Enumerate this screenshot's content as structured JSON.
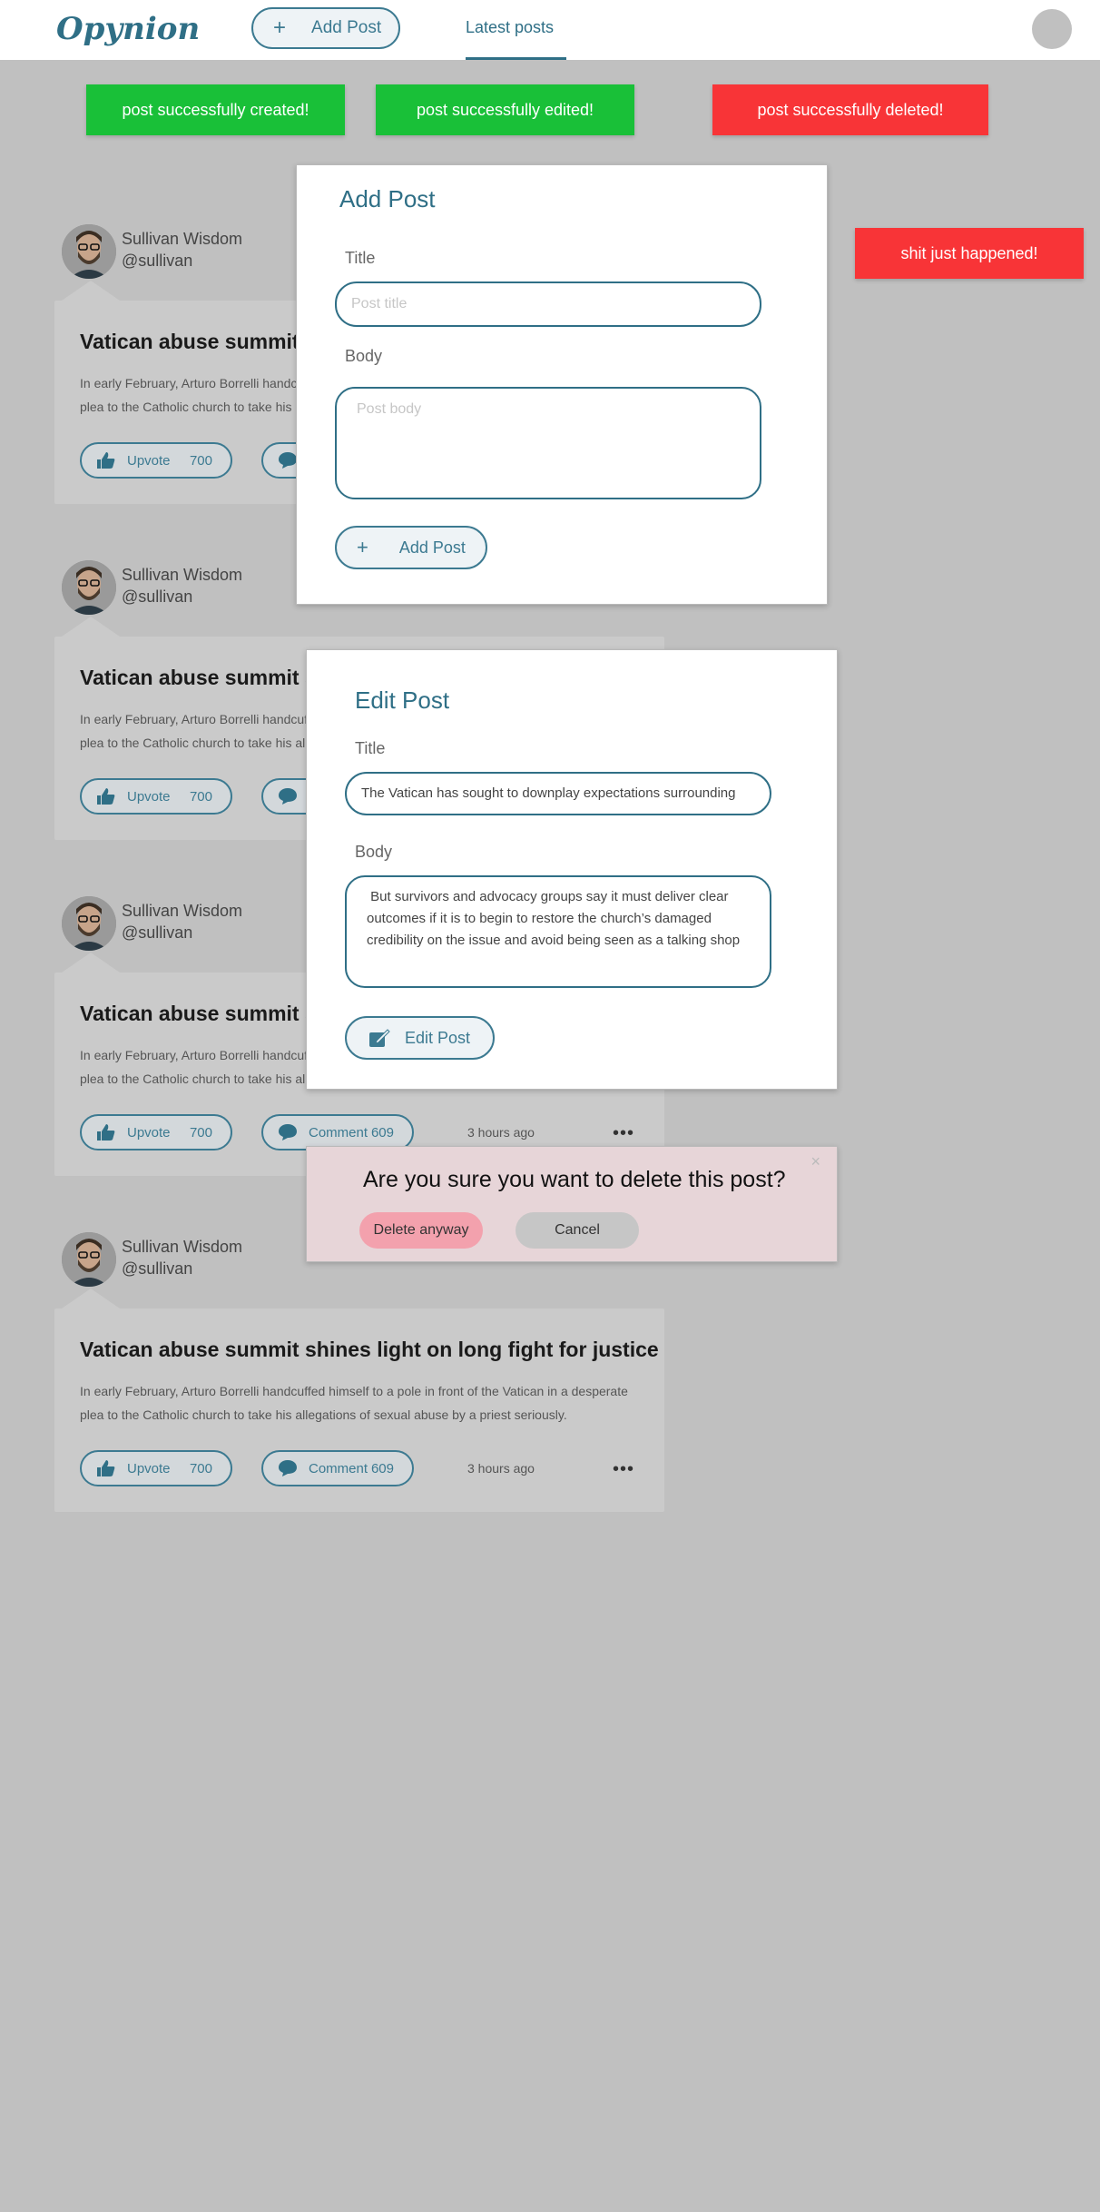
{
  "header": {
    "logo": "Opynion",
    "add_post_label": "Add Post",
    "tab_latest": "Latest posts"
  },
  "toasts": {
    "created": "post successfully created!",
    "edited": "post successfully edited!",
    "deleted": "post successfully deleted!",
    "error": "shit just happened!"
  },
  "posts": [
    {
      "author_name": "Sullivan Wisdom",
      "author_handle": "@sullivan",
      "title": "Vatican abuse summit shines light on long fight for justice",
      "body": "In early February, Arturo Borrelli handcuffed himself to a pole in front of the Vatican in a desperate plea to the Catholic church to take his allegations of sexual abuse by a priest seriously.",
      "upvote_label": "Upvote",
      "upvotes": "700",
      "comment_label": "Comment",
      "comments": "609",
      "time": "3 hours ago"
    }
  ],
  "add_modal": {
    "heading": "Add Post",
    "title_label": "Title",
    "title_placeholder": "Post title",
    "body_label": "Body",
    "body_placeholder": "Post body",
    "button": "Add Post"
  },
  "edit_modal": {
    "heading": "Edit Post",
    "title_label": "Title",
    "title_value": "The Vatican has sought to downplay expectations surrounding",
    "body_label": "Body",
    "body_value": " But survivors and advocacy groups say it must deliver clear outcomes if it is to begin to restore the church’s damaged credibility on the issue and avoid being seen as a talking shop",
    "button": "Edit Post"
  },
  "confirm_dialog": {
    "question": "Are you sure you want to delete this post?",
    "delete_label": "Delete anyway",
    "cancel_label": "Cancel",
    "close_glyph": "×"
  },
  "colors": {
    "accent": "#2f6f86",
    "success": "#19c038",
    "danger": "#f83437",
    "backdrop": "#c0c0c0"
  }
}
